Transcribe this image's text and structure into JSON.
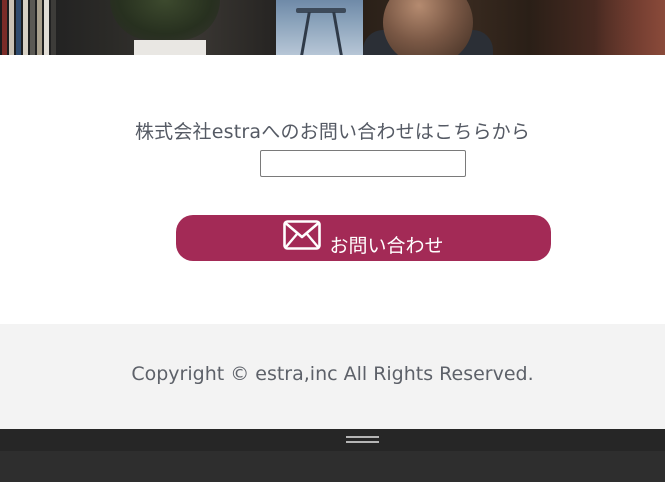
{
  "contact": {
    "heading": "株式会社estraへのお問い合わせはこちらから",
    "input_value": "",
    "button_label": "お問い合わせ",
    "button_icon": "envelope-icon",
    "accent_color": "#a32a56"
  },
  "footer": {
    "copyright": "Copyright © estra,inc All Rights Reserved."
  },
  "bottom_bar": {
    "handle_icon": "drag-handle-icon"
  }
}
